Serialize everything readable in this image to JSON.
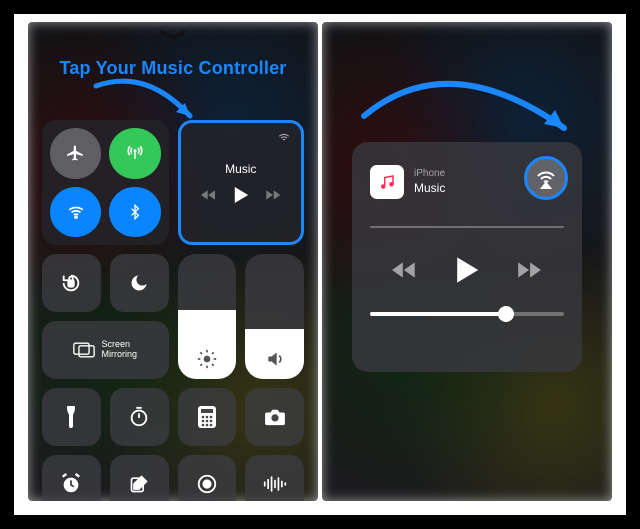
{
  "annotation": {
    "text": "Tap Your Music Controller"
  },
  "left": {
    "music": {
      "title": "Music"
    },
    "screen_mirroring_label": "Screen\nMirroring",
    "brightness_pct": 55,
    "volume_pct": 40
  },
  "right": {
    "source": "iPhone",
    "title": "Music",
    "progress_pct": 0,
    "volume_pct": 70
  },
  "colors": {
    "accent": "#1a87ff",
    "green": "#34c759",
    "blue": "#0a84ff"
  }
}
